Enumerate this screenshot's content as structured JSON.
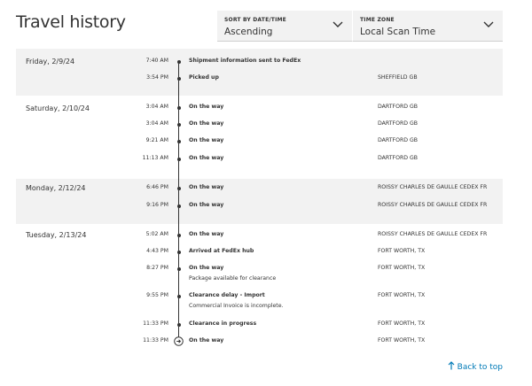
{
  "title": "Travel history",
  "sort": {
    "label": "SORT BY DATE/TIME",
    "value": "Ascending",
    "icon": "chevron-down-icon"
  },
  "timezone": {
    "label": "TIME ZONE",
    "value": "Local Scan Time",
    "icon": "chevron-down-icon"
  },
  "days": [
    {
      "date": "Friday, 2/9/24",
      "events": [
        {
          "time": "7:40 AM",
          "description": "Shipment information sent to FedEx",
          "location": ""
        },
        {
          "time": "3:54 PM",
          "description": "Picked up",
          "location": "SHEFFIELD GB"
        }
      ]
    },
    {
      "date": "Saturday, 2/10/24",
      "events": [
        {
          "time": "3:04 AM",
          "description": "On the way",
          "location": "DARTFORD GB"
        },
        {
          "time": "3:04 AM",
          "description": "On the way",
          "location": "DARTFORD GB"
        },
        {
          "time": "9:21 AM",
          "description": "On the way",
          "location": "DARTFORD GB"
        },
        {
          "time": "11:13 AM",
          "description": "On the way",
          "location": "DARTFORD GB"
        }
      ]
    },
    {
      "date": "Monday, 2/12/24",
      "events": [
        {
          "time": "6:46 PM",
          "description": "On the way",
          "location": "ROISSY CHARLES DE GAULLE CEDEX FR"
        },
        {
          "time": "9:16 PM",
          "description": "On the way",
          "location": "ROISSY CHARLES DE GAULLE CEDEX FR"
        }
      ]
    },
    {
      "date": "Tuesday, 2/13/24",
      "events": [
        {
          "time": "5:02 AM",
          "description": "On the way",
          "location": "ROISSY CHARLES DE GAULLE CEDEX FR"
        },
        {
          "time": "4:43 PM",
          "description": "Arrived at FedEx hub",
          "location": "FORT WORTH, TX"
        },
        {
          "time": "8:27 PM",
          "description": "On the way",
          "detail": "Package available for clearance",
          "location": "FORT WORTH, TX"
        },
        {
          "time": "9:55 PM",
          "description": "Clearance delay - Import",
          "detail": "Commercial Invoice is incomplete.",
          "location": "FORT WORTH, TX"
        },
        {
          "time": "11:33 PM",
          "description": "Clearance in progress",
          "location": "FORT WORTH, TX"
        },
        {
          "time": "11:33 PM",
          "description": "On the way",
          "location": "FORT WORTH, TX"
        }
      ]
    }
  ],
  "back_to_top": "Back to top",
  "colors": {
    "link": "#007ab7",
    "shaded_row": "#f2f2f2",
    "text": "#333333"
  }
}
